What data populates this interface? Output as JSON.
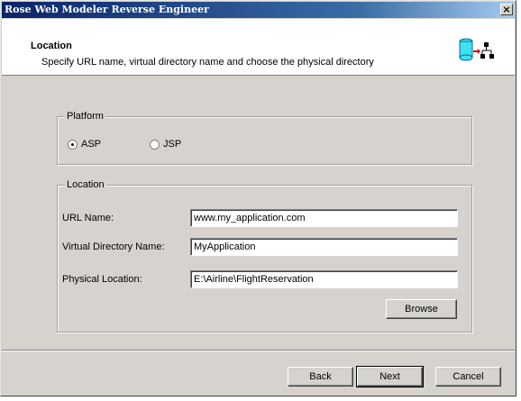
{
  "window": {
    "title": "Rose Web Modeler Reverse Engineer",
    "close_label": "×"
  },
  "header": {
    "title": "Location",
    "subtitle": "Specify URL name, virtual directory name and choose the physical directory",
    "icon": "database-to-hierarchy-icon"
  },
  "platform": {
    "legend": "Platform",
    "options": [
      {
        "label": "ASP",
        "selected": true
      },
      {
        "label": "JSP",
        "selected": false
      }
    ]
  },
  "location": {
    "legend": "Location",
    "url_label": "URL Name:",
    "url_value": "www.my_application.com",
    "vdir_label": "Virtual Directory Name:",
    "vdir_value": "MyApplication",
    "phys_label": "Physical Location:",
    "phys_value": "E:\\Airline\\FlightReservation",
    "browse_label": "Browse"
  },
  "buttons": {
    "back": "Back",
    "next": "Next",
    "cancel": "Cancel"
  }
}
